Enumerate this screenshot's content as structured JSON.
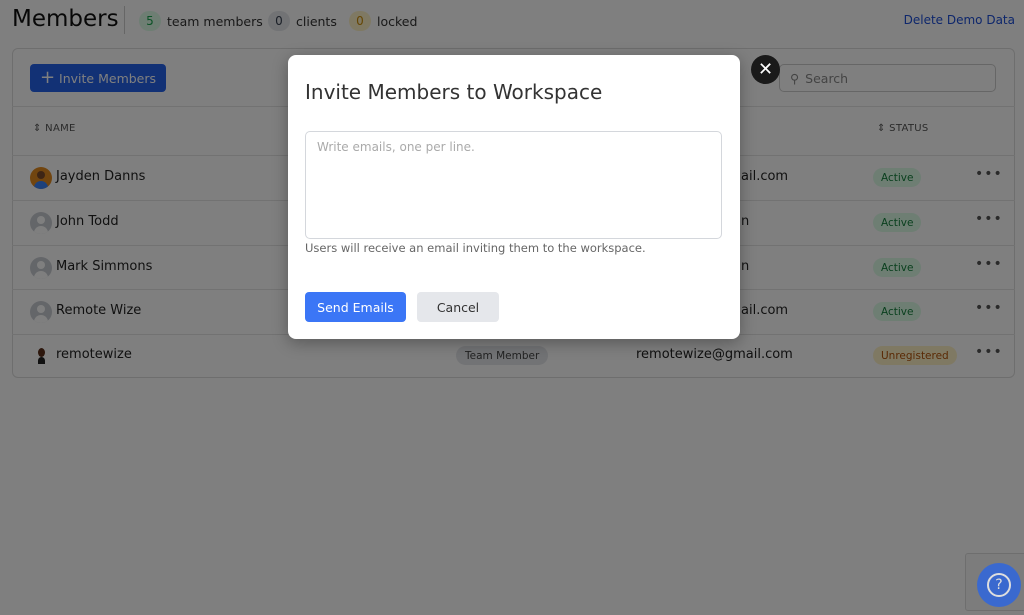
{
  "header": {
    "title": "Members",
    "counts": [
      {
        "value": "5",
        "label": "team members",
        "color": "#16a34a"
      },
      {
        "value": "0",
        "label": "clients",
        "color": "#374151"
      },
      {
        "value": "0",
        "label": "locked",
        "color": "#ca8a04"
      }
    ],
    "delete_demo": "Delete Demo Data"
  },
  "toolbar": {
    "invite_label": "Invite Members",
    "search_placeholder": "Search"
  },
  "table": {
    "columns": {
      "name": "NAME",
      "status": "STATUS"
    },
    "rows": [
      {
        "name": "Jayden Danns",
        "email_visible": "ail.com",
        "status": "Active",
        "avatar": "photo"
      },
      {
        "name": "John Todd",
        "email_visible": "n",
        "status": "Active",
        "avatar": "placeholder"
      },
      {
        "name": "Mark Simmons",
        "email_visible": "n",
        "status": "Active",
        "avatar": "placeholder"
      },
      {
        "name": "Remote Wize",
        "email_visible": "ail.com",
        "status": "Active",
        "avatar": "placeholder"
      },
      {
        "name": "remotewize",
        "role": "Team Member",
        "email": "remotewize@gmail.com",
        "status": "Unregistered",
        "avatar": "photo-small"
      }
    ]
  },
  "modal": {
    "title": "Invite Members to Workspace",
    "emails_value": "",
    "emails_placeholder": "Write emails, one per line.",
    "helper": "Users will receive an email inviting them to the workspace.",
    "send_label": "Send Emails",
    "cancel_label": "Cancel",
    "close_icon": "close-icon"
  },
  "colors": {
    "primary": "#2563eb",
    "overlay": "rgba(0,0,0,0.5)"
  }
}
